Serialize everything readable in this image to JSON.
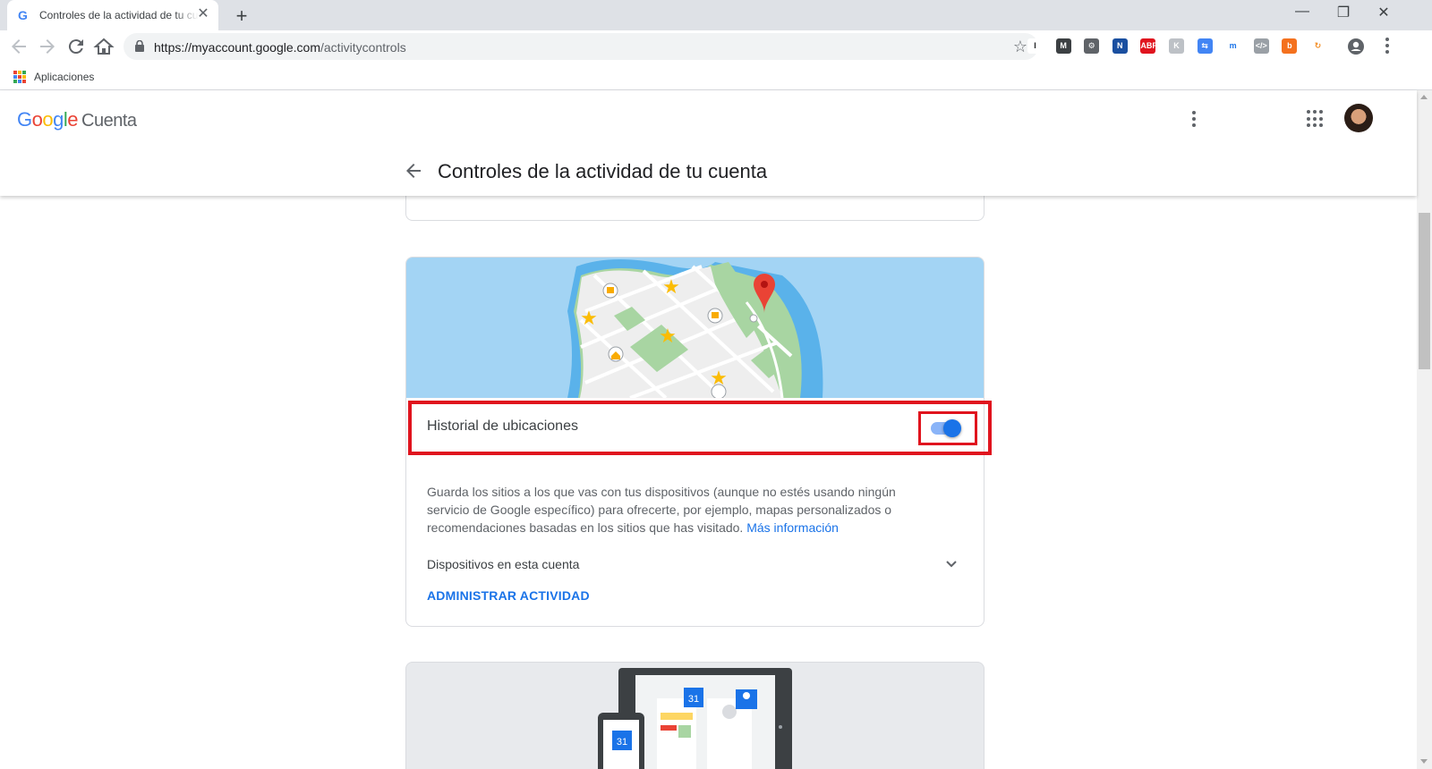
{
  "browser": {
    "tab_title": "Controles de la actividad de tu cuenta",
    "tab_favicon": "G",
    "url_host": "https://myaccount.google.com",
    "url_path": "/activitycontrols",
    "bookmarks_apps_label": "Aplicaciones",
    "extensions": [
      {
        "icon": "I",
        "color": "#ffffff",
        "text_color": "#202124"
      },
      {
        "icon": "M",
        "color": "#3c4043",
        "text_color": "#ffffff"
      },
      {
        "icon": "⚙",
        "color": "#5f6368",
        "text_color": "#ffffff"
      },
      {
        "icon": "N",
        "color": "#1a4fa0",
        "text_color": "#ffffff"
      },
      {
        "icon": "ABP",
        "color": "#e0141e",
        "text_color": "#ffffff"
      },
      {
        "icon": "K",
        "color": "#bdc1c6",
        "text_color": "#ffffff"
      },
      {
        "icon": "⇆",
        "color": "#4285f4",
        "text_color": "#ffffff"
      },
      {
        "icon": "m",
        "color": "#ffffff",
        "text_color": "#1a73e8"
      },
      {
        "icon": "</>",
        "color": "#9aa0a6",
        "text_color": "#ffffff"
      },
      {
        "icon": "b",
        "color": "#f4711e",
        "text_color": "#ffffff"
      },
      {
        "icon": "↻",
        "color": "#ffffff",
        "text_color": "#f28b20"
      }
    ]
  },
  "header": {
    "logo_letters": [
      {
        "ch": "G",
        "color": "#4285f4"
      },
      {
        "ch": "o",
        "color": "#ea4335"
      },
      {
        "ch": "o",
        "color": "#fbbc05"
      },
      {
        "ch": "g",
        "color": "#4285f4"
      },
      {
        "ch": "l",
        "color": "#34a853"
      },
      {
        "ch": "e",
        "color": "#ea4335"
      }
    ],
    "logo_suffix": "Cuenta",
    "page_title": "Controles de la actividad de tu cuenta"
  },
  "location_card": {
    "toggle_label": "Historial de ubicaciones",
    "toggle_on": true,
    "description": "Guarda los sitios a los que vas con tus dispositivos (aunque no estés usando ningún servicio de Google específico) para ofrecerte, por ejemplo, mapas personalizados o recomendaciones basadas en los sitios que has visitado.",
    "more_info_link": "Más información",
    "devices_label": "Dispositivos en esta cuenta",
    "manage_button": "ADMINISTRAR ACTIVIDAD"
  },
  "next_card": {
    "calendar_day": "31"
  },
  "colors": {
    "accent": "#1a73e8",
    "highlight": "#e0141e",
    "map_water": "#a3d4f4",
    "map_park": "#a8d5a2"
  }
}
